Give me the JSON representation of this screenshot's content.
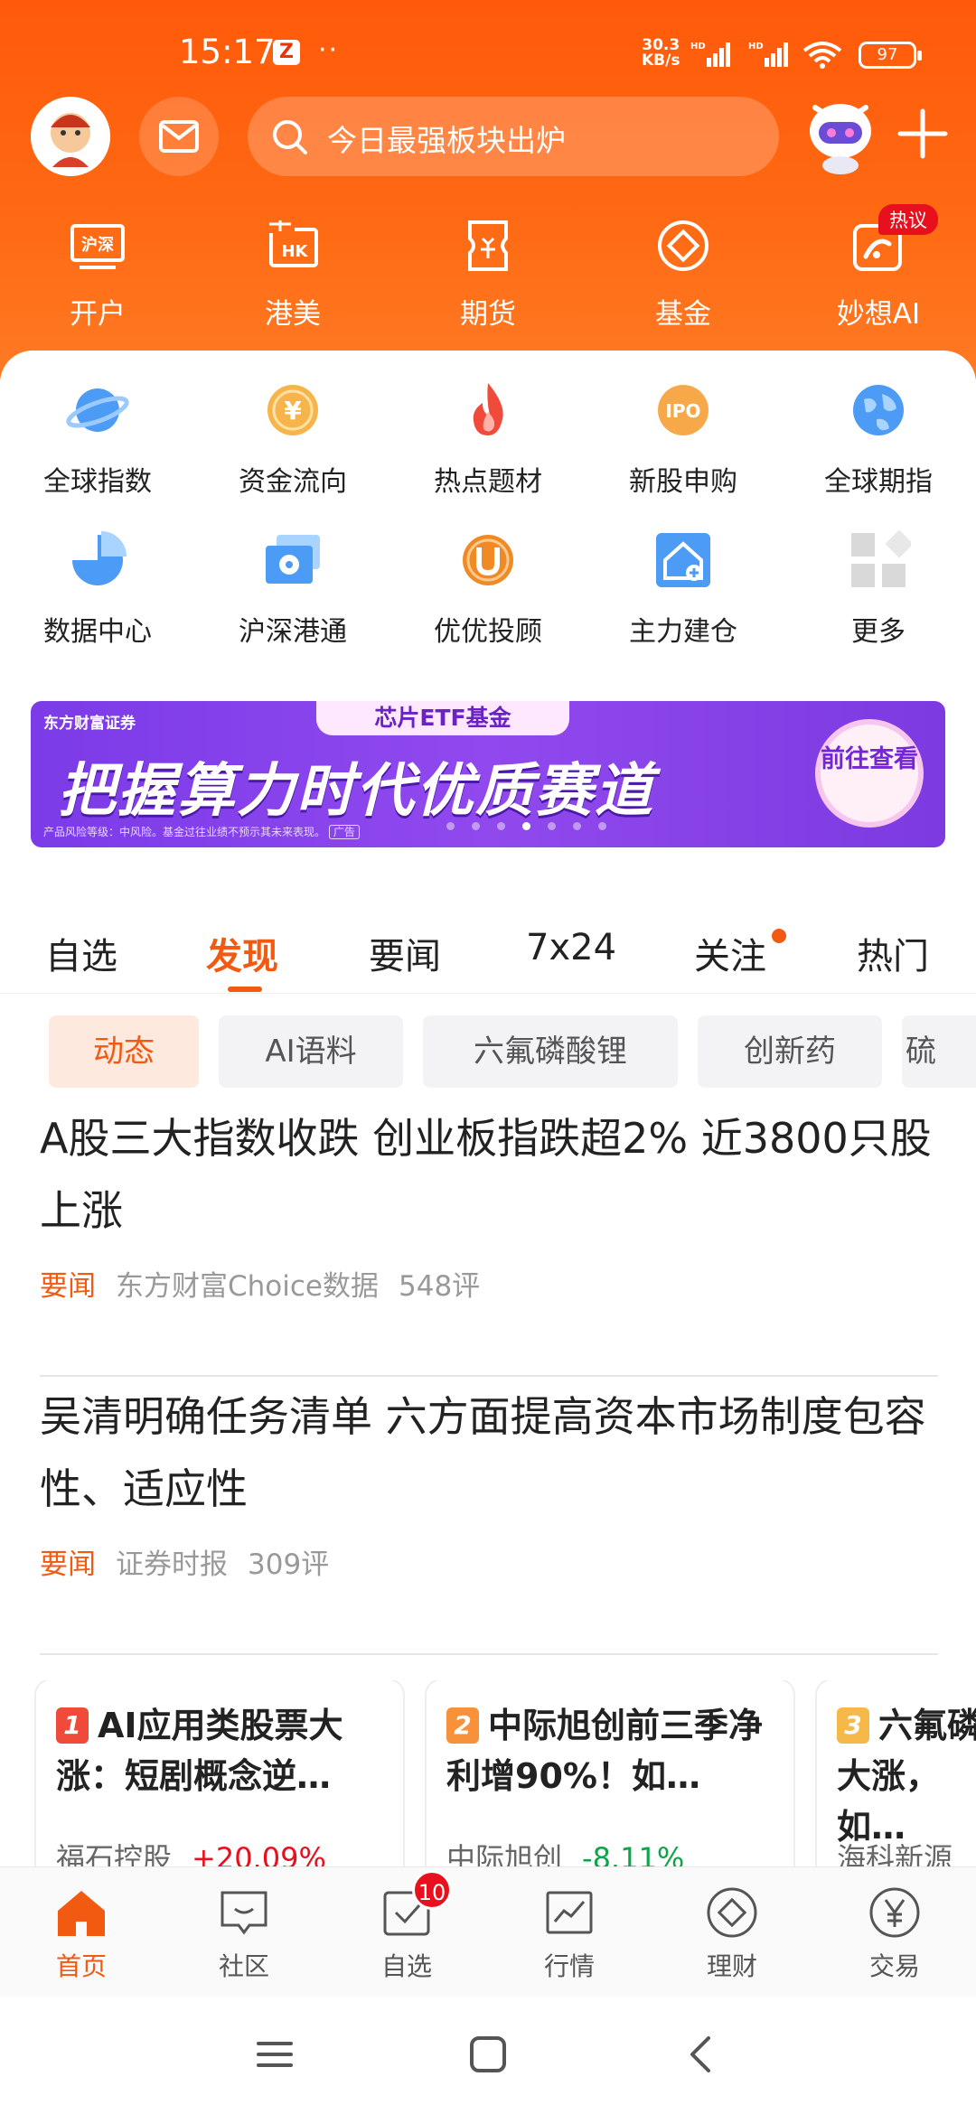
{
  "status_bar": {
    "time": "15:17",
    "app_badge": "Z",
    "dots": "··",
    "net_speed_value": "30.3",
    "net_speed_unit": "KB/s",
    "sim_label_1": "HD",
    "sim_label_2": "HD",
    "battery": "97"
  },
  "header": {
    "search_placeholder": "今日最强板块出炉"
  },
  "quick_entries": [
    {
      "label": "开户",
      "icon": "hushen-icon"
    },
    {
      "label": "港美",
      "icon": "hk-icon"
    },
    {
      "label": "期货",
      "icon": "futures-icon"
    },
    {
      "label": "基金",
      "icon": "fund-icon"
    },
    {
      "label": "妙想AI",
      "icon": "ai-icon",
      "tag": "热议"
    }
  ],
  "grid": [
    {
      "label": "全球指数",
      "icon": "planet-icon"
    },
    {
      "label": "资金流向",
      "icon": "yen-coin-icon"
    },
    {
      "label": "热点题材",
      "icon": "flame-icon"
    },
    {
      "label": "新股申购",
      "icon": "ipo-icon"
    },
    {
      "label": "全球期指",
      "icon": "globe-icon"
    },
    {
      "label": "数据中心",
      "icon": "pie-chart-icon"
    },
    {
      "label": "沪深港通",
      "icon": "hk-flower-icon"
    },
    {
      "label": "优优投顾",
      "icon": "advisor-icon"
    },
    {
      "label": "主力建仓",
      "icon": "house-icon"
    },
    {
      "label": "更多",
      "icon": "more-grid-icon"
    }
  ],
  "banner": {
    "brand": "东方财富证券",
    "tagline": "芯片ETF基金",
    "headline": "把握算力时代优质赛道",
    "risk": "产品风险等级：中风险。基金过往业绩不预示其未来表现。",
    "ad_label": "广告",
    "cta": "前往查看",
    "slide_count": 7,
    "active_slide": 4
  },
  "tabs": [
    {
      "label": "自选"
    },
    {
      "label": "发现",
      "active": true
    },
    {
      "label": "要闻"
    },
    {
      "label": "7x24"
    },
    {
      "label": "关注",
      "dot": true
    },
    {
      "label": "热门"
    }
  ],
  "chips": [
    "动态",
    "AI语料",
    "六氟磷酸锂",
    "创新药",
    "硫"
  ],
  "news": [
    {
      "title": "A股三大指数收跌 创业板指跌超2% 近3800只股上涨",
      "category": "要闻",
      "source": "东方财富Choice数据",
      "comments": "548评"
    },
    {
      "title": "吴清明确任务清单 六方面提高资本市场制度包容性、适应性",
      "category": "要闻",
      "source": "证券时报",
      "comments": "309评"
    }
  ],
  "hot_cards": [
    {
      "rank": "1",
      "title": "AI应用类股票大涨：短剧概念逆…",
      "stock": "福石控股",
      "change": "+20.09%",
      "direction": "up"
    },
    {
      "rank": "2",
      "title": "中际旭创前三季净利增90%！如…",
      "stock": "中际旭创",
      "change": "-8.11%",
      "direction": "down"
    },
    {
      "rank": "3",
      "title": "六氟磷大涨，如…",
      "stock": "海科新源",
      "change": "",
      "direction": "up"
    }
  ],
  "bottom_nav": [
    {
      "label": "首页",
      "icon": "home-icon",
      "active": true
    },
    {
      "label": "社区",
      "icon": "chat-icon"
    },
    {
      "label": "自选",
      "icon": "watchlist-icon",
      "badge": "10"
    },
    {
      "label": "行情",
      "icon": "market-chart-icon"
    },
    {
      "label": "理财",
      "icon": "diamond-icon"
    },
    {
      "label": "交易",
      "icon": "yen-icon"
    }
  ],
  "colors": {
    "brand_orange": "#ff5a0a",
    "accent": "#f25a12",
    "up": "#e8101d",
    "down": "#0fa34a"
  }
}
